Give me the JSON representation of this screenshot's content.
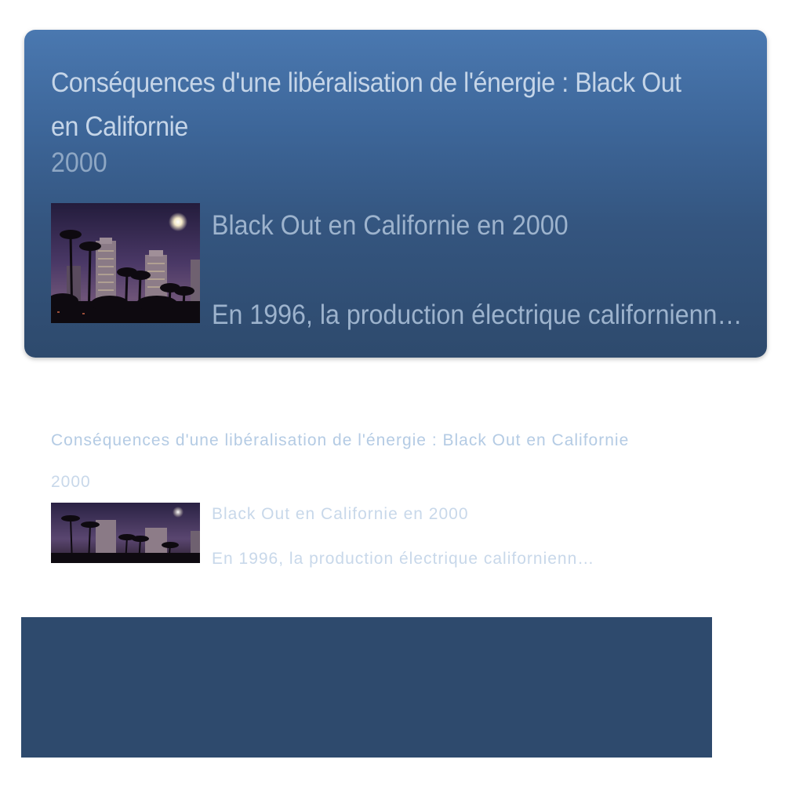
{
  "card": {
    "title": "Conséquences d'une libéralisation de l'énergie : Black Out en Californie",
    "year": "2000",
    "headline": "Black Out en Californie en 2000",
    "summary": "En 1996, la production électrique californienn…",
    "thumbnail": "night-city-palm-trees-image"
  },
  "ghost": {
    "title": "Conséquences d'une libéralisation de l'énergie : Black Out en Californie",
    "year": "2000",
    "headline": "Black Out en Californie en 2000",
    "summary": "En 1996, la production électrique californienn…",
    "thumbnail": "night-city-palm-trees-image"
  },
  "colors": {
    "card_top": "#4a78b0",
    "card_bottom": "#2e4a6d",
    "panel": "#2e4a6d",
    "ghost_text": "#b4cbe4"
  }
}
